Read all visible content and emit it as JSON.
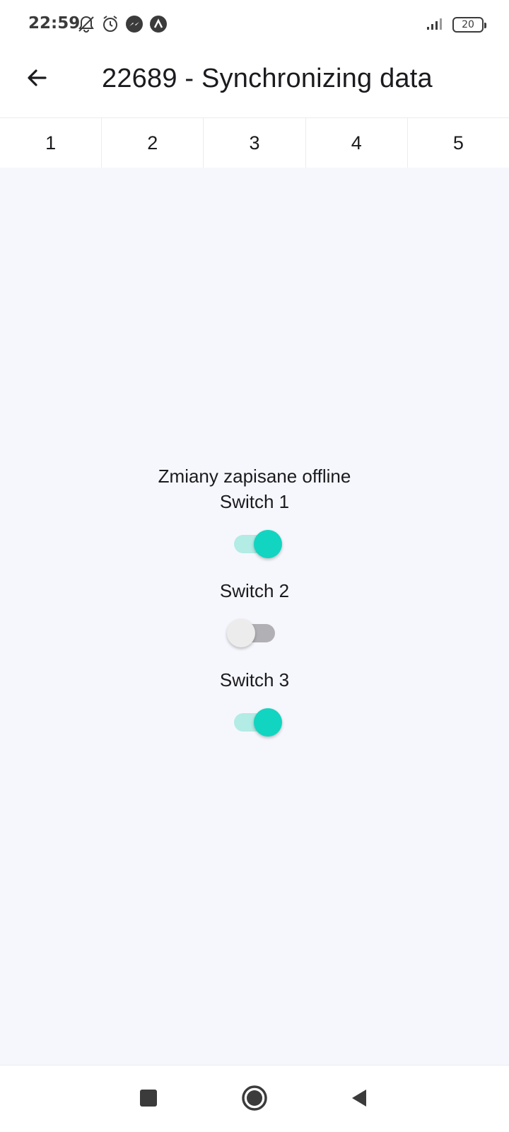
{
  "status_bar": {
    "time": "22:59",
    "icons": [
      "mute-bell-icon",
      "alarm-icon",
      "messenger-icon",
      "app-notification-icon"
    ],
    "battery": "20",
    "signal": "signal-icon"
  },
  "app_bar": {
    "title": "22689 - Synchronizing data",
    "back_icon": "arrow-back-icon"
  },
  "tabs": [
    {
      "label": "1"
    },
    {
      "label": "2"
    },
    {
      "label": "3"
    },
    {
      "label": "4"
    },
    {
      "label": "5"
    }
  ],
  "main": {
    "message": "Zmiany zapisane offline",
    "switches": [
      {
        "label": "Switch 1",
        "on": true
      },
      {
        "label": "Switch 2",
        "on": false
      },
      {
        "label": "Switch 3",
        "on": true
      }
    ]
  },
  "colors": {
    "accent": "#11d5c0",
    "accent_track": "#b3ebe5",
    "background": "#f6f7fc"
  },
  "nav_bar": {
    "buttons": [
      "recent-apps-icon",
      "home-icon",
      "back-triangle-icon"
    ]
  }
}
